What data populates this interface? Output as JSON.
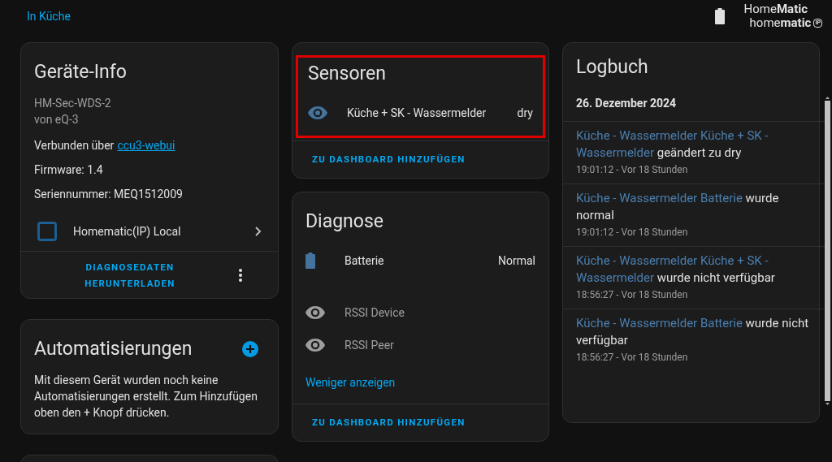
{
  "breadcrumb": "In Küche",
  "logo": {
    "line_1": "Home**Matic**",
    "line_2": "home**matic**",
    "badge": "IP"
  },
  "device_info": {
    "title": "Geräte-Info",
    "model": "HM-Sec-WDS-2",
    "maker": "von eQ-3",
    "connected_prefix": "Verbunden über",
    "connected_link": "ccu3-webui",
    "firmware": "Firmware: 1.4",
    "serial": "Seriennummer: MEQ1512009",
    "integration": "Homematic(IP) Local",
    "download_button": "DIAGNOSEDATEN HERUNTERLADEN"
  },
  "automations": {
    "title": "Automatisierungen",
    "text": "Mit diesem Gerät wurden noch keine Automatisierungen erstellt. Zum Hinzufügen oben den + Knopf drücken."
  },
  "sensors": {
    "title": "Sensoren",
    "highlighted": true,
    "rows": [
      {
        "kind": "eye",
        "name": "Küche + SK - Wassermelder",
        "value": "dry",
        "disabled": false
      }
    ],
    "add_button": "ZU DASHBOARD HINZUFÜGEN"
  },
  "diagnostics": {
    "title": "Diagnose",
    "rows": [
      {
        "kind": "battery",
        "name": "Batterie",
        "value": "Normal",
        "disabled": false
      },
      {
        "kind": "eye",
        "name": "RSSI Device",
        "disabled": true
      },
      {
        "kind": "eye",
        "name": "RSSI Peer",
        "disabled": true
      }
    ],
    "less_link": "Weniger anzeigen",
    "add_button": "ZU DASHBOARD HINZUFÜGEN"
  },
  "logbook": {
    "title": "Logbuch",
    "date": "26. Dezember 2024",
    "entries": [
      {
        "entity": "Küche - Wassermelder Küche + SK - Wassermelder",
        "message": "geändert zu dry",
        "time": "19:01:12 - Vor 18 Stunden"
      },
      {
        "entity": "Küche - Wassermelder Batterie",
        "message": "wurde normal",
        "time": "19:01:12 - Vor 18 Stunden"
      },
      {
        "entity": "Küche - Wassermelder Küche + SK - Wassermelder",
        "message": "wurde nicht verfügbar",
        "time": "18:56:27 - Vor 18 Stunden"
      },
      {
        "entity": "Küche - Wassermelder Batterie",
        "message": "wurde nicht verfügbar",
        "time": "18:56:27 - Vor 18 Stunden"
      }
    ]
  }
}
